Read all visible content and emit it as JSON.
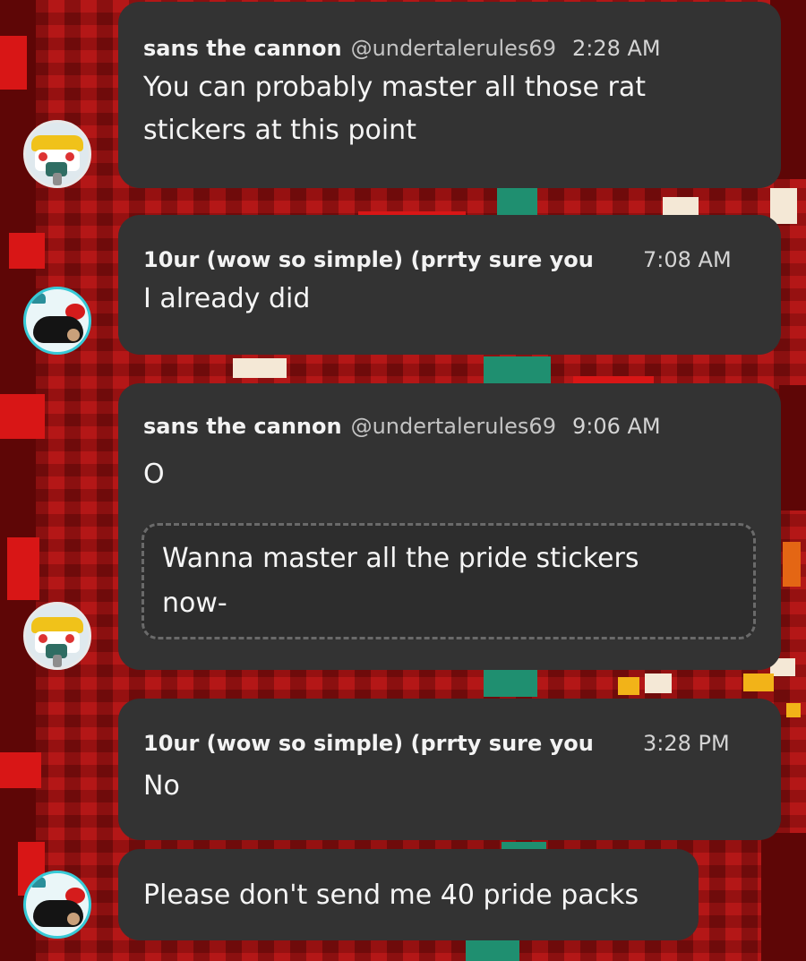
{
  "colors": {
    "bubble": "#333333",
    "background": "#a01010",
    "username": "#f3f3f3",
    "handle": "#c4c4c4",
    "timestamp": "#d4d4d4"
  },
  "messages": [
    {
      "author": "sans the cannon",
      "handle": "@undertalerules69",
      "time": "2:28 AM",
      "text_lines": [
        "You can probably master all those rat",
        "stickers at this point"
      ],
      "avatar": "sans-avatar"
    },
    {
      "author": "10ur (wow so simple) (prrty sure you",
      "time": "7:08 AM",
      "text_lines": [
        "I already did"
      ],
      "avatar": "rat-avatar"
    },
    {
      "author": "sans the cannon",
      "handle": "@undertalerules69",
      "time": "9:06 AM",
      "text_lines": [
        "O"
      ],
      "quote_lines": [
        "Wanna master all the pride stickers",
        "now-"
      ],
      "avatar": "sans-avatar"
    },
    {
      "author": "10ur (wow so simple) (prrty sure you",
      "time": "3:28 PM",
      "text_lines": [
        "No"
      ],
      "avatar": "rat-avatar"
    },
    {
      "text_lines": [
        "Please don't send me 40 pride packs"
      ],
      "avatar": "rat-avatar"
    }
  ]
}
